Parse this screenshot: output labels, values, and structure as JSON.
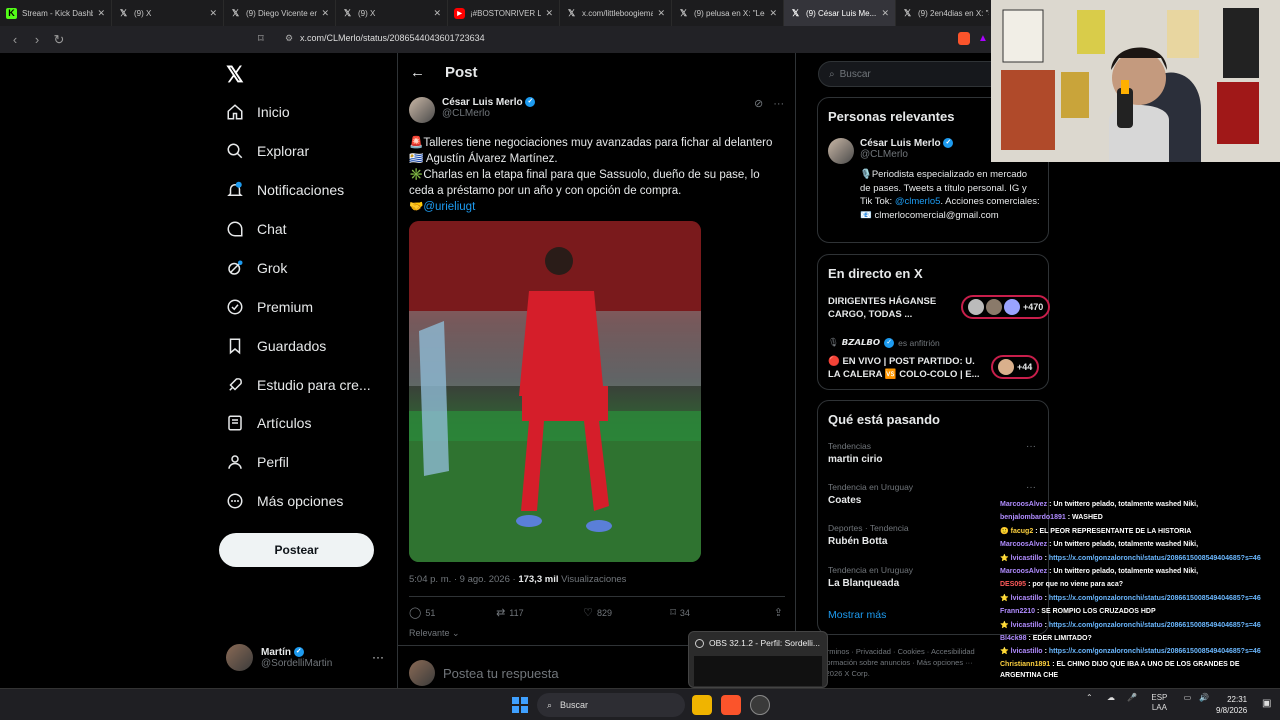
{
  "browser": {
    "tabs": [
      {
        "title": "Stream - Kick Dashbo...",
        "icon": "kick-icon",
        "active": false
      },
      {
        "title": "(9) X",
        "icon": "x-icon",
        "active": false
      },
      {
        "title": "(9) Diego Vicente en X",
        "icon": "x-icon",
        "active": false
      },
      {
        "title": "(9) X",
        "icon": "x-icon",
        "active": false
      },
      {
        "title": "¡#BOSTONRIVER LO D...",
        "icon": "youtube-icon",
        "active": false
      },
      {
        "title": "x.com/littleboogiema...",
        "icon": "x-icon",
        "active": false
      },
      {
        "title": "(9) pelusa en X: \"Leom...",
        "icon": "x-icon",
        "active": false
      },
      {
        "title": "(9) César Luis Me...",
        "icon": "x-icon",
        "active": true
      },
      {
        "title": "(9) 2en4dias en X: \"#...",
        "icon": "x-icon",
        "active": false
      }
    ],
    "url": "x.com/CLMerlo/status/2086544043601723634"
  },
  "sidebar": {
    "items": [
      {
        "label": "Inicio",
        "icon": "home-icon"
      },
      {
        "label": "Explorar",
        "icon": "search-icon"
      },
      {
        "label": "Notificaciones",
        "icon": "bell-icon"
      },
      {
        "label": "Chat",
        "icon": "chat-icon"
      },
      {
        "label": "Grok",
        "icon": "grok-icon"
      },
      {
        "label": "Premium",
        "icon": "premium-icon"
      },
      {
        "label": "Guardados",
        "icon": "bookmark-icon"
      },
      {
        "label": "Estudio para cre...",
        "icon": "rocket-icon"
      },
      {
        "label": "Artículos",
        "icon": "article-icon"
      },
      {
        "label": "Perfil",
        "icon": "profile-icon"
      },
      {
        "label": "Más opciones",
        "icon": "more-icon"
      }
    ],
    "post_button": "Postear",
    "account": {
      "name": "Martín",
      "handle": "@SordelliMartin",
      "more": "···"
    }
  },
  "post": {
    "header": "Post",
    "author": {
      "name": "César Luis Merlo",
      "handle": "@CLMerlo"
    },
    "body": {
      "line1": "🚨Talleres tiene negociaciones muy avanzadas para fichar al delantero",
      "line2": "🇺🇾 Agustín Álvarez Martínez.",
      "line3": "✳️Charlas en la etapa final para que Sassuolo, dueño de su pase, lo ceda a préstamo por un año y con opción de compra.",
      "mention": "🤝@urieliugt"
    },
    "meta": {
      "time": "5:04 p. m. · 9 ago. 2026 · ",
      "views_count": "173,3 mil",
      "views_label": " Visualizaciones"
    },
    "stats": {
      "replies": "51",
      "reposts": "117",
      "likes": "829",
      "bookmarks": "34"
    },
    "relevance": "Relevante",
    "reply_placeholder": "Postea tu respuesta"
  },
  "right": {
    "search_placeholder": "Buscar",
    "relevant": {
      "title": "Personas relevantes",
      "name": "César Luis Merlo",
      "handle": "@CLMerlo",
      "bio_a": "🎙️Periodista especializado en mercado de pases. Tweets a título personal. IG y Tik Tok: ",
      "bio_link": "@clmerlo5",
      "bio_b": ". Acciones comerciales: 📧 clmerlocomercial@gmail.com"
    },
    "live": {
      "title": "En directo en X",
      "item1": "DIRIGENTES HÁGANSE CARGO, TODAS ...",
      "item1_count": "+470",
      "host": "𝘽𝙕𝘼𝙇𝘽𝙊",
      "host_role": "es anfitrión",
      "item2": "🔴 EN VIVO | POST PARTIDO: U. LA CALERA 🆚 COLO-COLO | E...",
      "item2_count": "+44"
    },
    "trends": {
      "title": "Qué está pasando",
      "items": [
        {
          "context": "Tendencias",
          "name": "martin cirio"
        },
        {
          "context": "Tendencia en Uruguay",
          "name": "Coates"
        },
        {
          "context": "Deportes · Tendencia",
          "name": "Rubén Botta"
        },
        {
          "context": "Tendencia en Uruguay",
          "name": "La Blanqueada"
        }
      ],
      "show_more": "Mostrar más"
    },
    "footer": {
      "line1": "Términos · Privacidad · Cookies · Accesibilidad",
      "line2": "Información sobre anuncios · Más opciones ···",
      "line3": "© 2026 X Corp."
    }
  },
  "chat": [
    {
      "user": "MarcoosAlvez",
      "color": "#b08cff",
      "msg": ": Un twittero pelado, totalmente washed Niki,"
    },
    {
      "user": "benjalombardo1891",
      "color": "#b08cff",
      "msg": ": WASHED"
    },
    {
      "user": "🙂 facug2",
      "color": "#ffd23f",
      "msg": ": EL PEOR REPRESENTANTE DE LA HISTORIA"
    },
    {
      "user": "MarcoosAlvez",
      "color": "#b08cff",
      "msg": ": Un twittero pelado, totalmente washed Niki,"
    },
    {
      "user": "⭐ lvicastillo",
      "color": "#b08cff",
      "msg": ": ",
      "link": "https://x.com/gonzaloronchi/status/2086615008549404685?s=46"
    },
    {
      "user": "MarcoosAlvez",
      "color": "#b08cff",
      "msg": ": Un twittero pelado, totalmente washed Niki,"
    },
    {
      "user": "DES095",
      "color": "#ff5a5a",
      "msg": ": por que no viene para aca?"
    },
    {
      "user": "⭐ lvicastillo",
      "color": "#b08cff",
      "msg": ": ",
      "link": "https://x.com/gonzaloronchi/status/2086615008549404685?s=46"
    },
    {
      "user": "Frann2210",
      "color": "#b08cff",
      "msg": ": SE ROMPIO LOS CRUZADOS HDP"
    },
    {
      "user": "⭐ lvicastillo",
      "color": "#b08cff",
      "msg": ": ",
      "link": "https://x.com/gonzaloronchi/status/2086615008549404685?s=46"
    },
    {
      "user": "Bl4ck98",
      "color": "#b08cff",
      "msg": ": EDER LIMITADO?"
    },
    {
      "user": "⭐ lvicastillo",
      "color": "#b08cff",
      "msg": ": ",
      "link": "https://x.com/gonzaloronchi/status/2086615008549404685?s=46"
    },
    {
      "user": "Christiann1891",
      "color": "#ffd23f",
      "msg": ": EL CHINO DIJO QUE IBA A UNO DE LOS GRANDES DE ARGENTINA CHE"
    }
  ],
  "obs_popup": {
    "title": "OBS 32.1.2 - Perfil: Sordelli..."
  },
  "taskbar": {
    "search": "Buscar",
    "lang1": "ESP",
    "lang2": "LAA",
    "time": "22:31",
    "date": "9/8/2026"
  },
  "colors": {
    "accent": "#1d9bf0",
    "background": "#000000",
    "live_border": "#c81e4b"
  }
}
